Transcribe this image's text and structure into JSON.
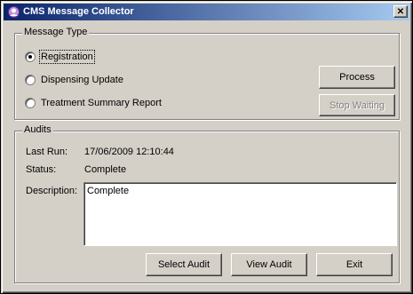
{
  "window": {
    "title": "CMS Message Collector",
    "close_glyph": "✕",
    "icon": "app-icon"
  },
  "message_type": {
    "legend": "Message Type",
    "options": [
      {
        "label": "Registration",
        "checked": true
      },
      {
        "label": "Dispensing Update",
        "checked": false
      },
      {
        "label": "Treatment Summary Report",
        "checked": false
      }
    ],
    "process_label": "Process",
    "stop_label": "Stop Waiting"
  },
  "audits": {
    "legend": "Audits",
    "last_run_label": "Last Run:",
    "last_run_value": "17/06/2009 12:10:44",
    "status_label": "Status:",
    "status_value": "Complete",
    "description_label": "Description:",
    "description_value": "Complete"
  },
  "buttons": {
    "select_audit": "Select Audit",
    "view_audit": "View Audit",
    "exit": "Exit"
  }
}
